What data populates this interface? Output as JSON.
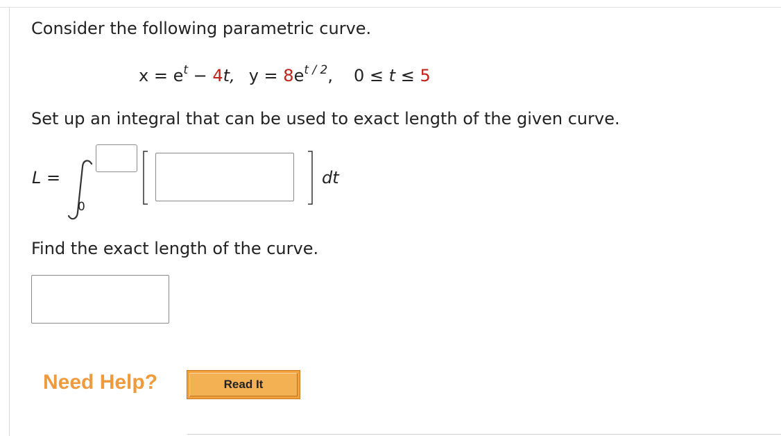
{
  "question": {
    "intro": "Consider the following parametric curve.",
    "equation": {
      "x_lhs": "x = e",
      "x_exp": "t",
      "x_minus": " − ",
      "x_coef": "4",
      "x_var": "t,",
      "y_lhs": "y = ",
      "y_coef": "8",
      "y_base": "e",
      "y_exp": "t / 2",
      "y_comma": ",",
      "range_start": "0 ≤ ",
      "range_var": "t",
      "range_mid": " ≤ ",
      "range_end": "5"
    },
    "setup_prompt": "Set up an integral that can be used to exact length of the given curve.",
    "integral": {
      "lhs_var": "L",
      "lhs_eq": " =",
      "lower_limit": "0",
      "differential": "dt",
      "upper_limit_value": "",
      "integrand_value": ""
    },
    "length_prompt": "Find the exact length of the curve.",
    "length_answer_value": ""
  },
  "help": {
    "need_help_label": "Need Help?",
    "read_it_label": "Read It"
  },
  "colors": {
    "given_value": "#c22018",
    "need_help": "#f09a3e",
    "read_it_button": "#f3a13c"
  }
}
